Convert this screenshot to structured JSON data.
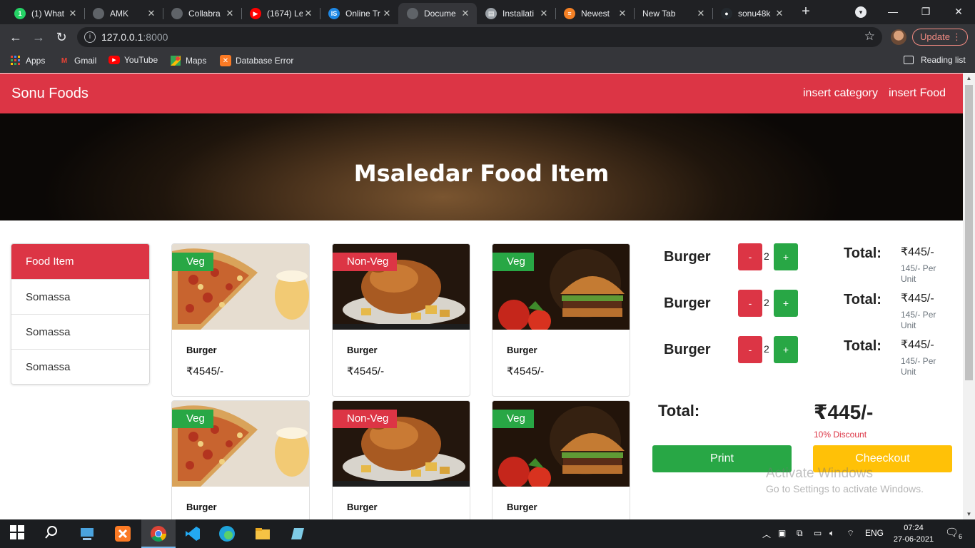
{
  "browser": {
    "tabs": [
      {
        "title": "(1) What",
        "fav_color": "#25d366",
        "fav_text": "1"
      },
      {
        "title": "AMK",
        "fav_color": "#5f6368",
        "fav_text": ""
      },
      {
        "title": "Collabra",
        "fav_color": "#5f6368",
        "fav_text": ""
      },
      {
        "title": "(1674) Le",
        "fav_color": "#ff0000",
        "fav_text": "▶"
      },
      {
        "title": "Online Tr",
        "fav_color": "#1e88e5",
        "fav_text": "IS"
      },
      {
        "title": "Docume",
        "fav_color": "#5f6368",
        "fav_text": ""
      },
      {
        "title": "Installati",
        "fav_color": "#9aa0a6",
        "fav_text": "▤"
      },
      {
        "title": "Newest",
        "fav_color": "#f48024",
        "fav_text": "≡"
      },
      {
        "title": "New Tab",
        "fav_color": "",
        "fav_text": ""
      },
      {
        "title": "sonu48k",
        "fav_color": "#24292e",
        "fav_text": "●"
      }
    ],
    "url_host": "127.0.0.1",
    "url_port": ":8000",
    "update_label": "Update",
    "bookmarks": [
      "Apps",
      "Gmail",
      "YouTube",
      "Maps",
      "Database Error"
    ],
    "reading_list": "Reading list"
  },
  "page": {
    "brand": "Sonu Foods",
    "nav": [
      "insert category",
      "insert Food"
    ],
    "hero_title": "Msaledar Food Item",
    "categories": [
      "Food Item",
      "Somassa",
      "Somassa",
      "Somassa"
    ],
    "foods": [
      {
        "badge": "Veg",
        "type": "veg",
        "image": "pizza",
        "name": "Burger",
        "price": "₹4545/-"
      },
      {
        "badge": "Non-Veg",
        "type": "nonveg",
        "image": "chicken",
        "name": "Burger",
        "price": "₹4545/-"
      },
      {
        "badge": "Veg",
        "type": "veg",
        "image": "burger",
        "name": "Burger",
        "price": "₹4545/-"
      },
      {
        "badge": "Veg",
        "type": "veg",
        "image": "pizza",
        "name": "Burger",
        "price": ""
      },
      {
        "badge": "Non-Veg",
        "type": "nonveg",
        "image": "chicken",
        "name": "Burger",
        "price": ""
      },
      {
        "badge": "Veg",
        "type": "veg",
        "image": "burger",
        "name": "Burger",
        "price": ""
      }
    ],
    "cart": [
      {
        "item": "Burger",
        "minus": "-",
        "qty": "2",
        "plus": "+",
        "total_label": "Total:",
        "total": "₹445/-",
        "unit": "145/- Per Unit"
      },
      {
        "item": "Burger",
        "minus": "-",
        "qty": "2",
        "plus": "+",
        "total_label": "Total:",
        "total": "₹445/-",
        "unit": "145/- Per Unit"
      },
      {
        "item": "Burger",
        "minus": "-",
        "qty": "2",
        "plus": "+",
        "total_label": "Total:",
        "total": "₹445/-",
        "unit": "145/- Per Unit"
      }
    ],
    "grand_total_label": "Total:",
    "grand_total": "₹445/-",
    "discount": "10% Discount",
    "print_label": "Print",
    "checkout_label": "Cheeckout",
    "watermark_title": "Activate Windows",
    "watermark_sub": "Go to Settings to activate Windows."
  },
  "taskbar": {
    "language": "ENG",
    "time": "07:24",
    "date": "27-06-2021",
    "notifications": "6"
  },
  "colors": {
    "brand_red": "#dc3545",
    "veg_green": "#28a745",
    "checkout_yellow": "#ffc107"
  }
}
